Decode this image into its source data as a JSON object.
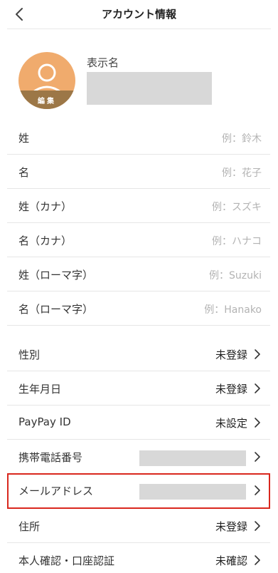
{
  "header": {
    "title": "アカウント情報"
  },
  "profile": {
    "display_name_label": "表示名",
    "avatar_edit_label": "編集",
    "avatar_color": "#f0ab6d",
    "avatar_edit_color": "#9c7747"
  },
  "name_fields": [
    {
      "label": "姓",
      "placeholder": "例：鈴木"
    },
    {
      "label": "名",
      "placeholder": "例：花子"
    },
    {
      "label": "姓（カナ）",
      "placeholder": "例：スズキ"
    },
    {
      "label": "名（カナ）",
      "placeholder": "例：ハナコ"
    },
    {
      "label": "姓（ローマ字）",
      "placeholder": "例：Suzuki"
    },
    {
      "label": "名（ローマ字）",
      "placeholder": "例：Hanako"
    }
  ],
  "detail_rows": [
    {
      "label": "性別",
      "value": "未登録"
    },
    {
      "label": "生年月日",
      "value": "未登録"
    },
    {
      "label": "PayPay ID",
      "value": "未設定"
    },
    {
      "label": "携帯電話番号",
      "value": ""
    },
    {
      "label": "メールアドレス",
      "value": ""
    },
    {
      "label": "住所",
      "value": "未登録"
    },
    {
      "label": "本人確認・口座認証",
      "value": "未確認"
    }
  ],
  "colors": {
    "highlight_border": "#d9281e",
    "masked_fill": "#d8d8d8"
  }
}
